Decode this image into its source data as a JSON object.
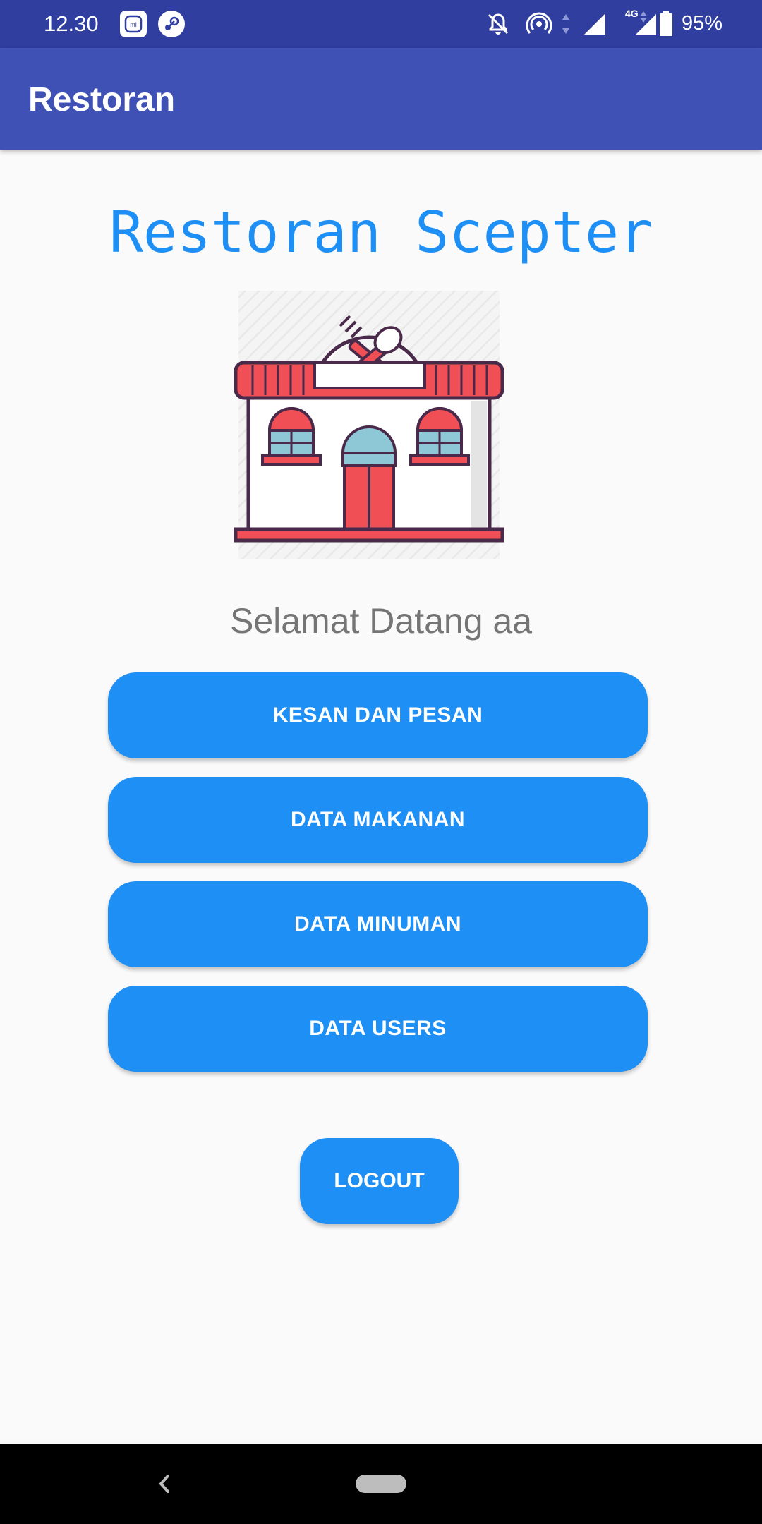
{
  "status_bar": {
    "time": "12.30",
    "battery": "95%",
    "network": "4G",
    "icons": [
      "mi-app-icon",
      "steam-icon",
      "notifications-off-icon",
      "hotspot-icon",
      "signal-icon",
      "signal-4g-icon",
      "battery-icon"
    ]
  },
  "app_bar": {
    "title": "Restoran"
  },
  "main": {
    "heading": "Restoran Scepter",
    "welcome": "Selamat Datang aa",
    "buttons": [
      "KESAN DAN PESAN",
      "DATA MAKANAN",
      "DATA MINUMAN",
      "DATA USERS"
    ],
    "logout": "LOGOUT"
  },
  "colors": {
    "status_bar": "#303f9f",
    "app_bar": "#3f51b5",
    "accent": "#1e8ff5",
    "background": "#fafafa"
  }
}
